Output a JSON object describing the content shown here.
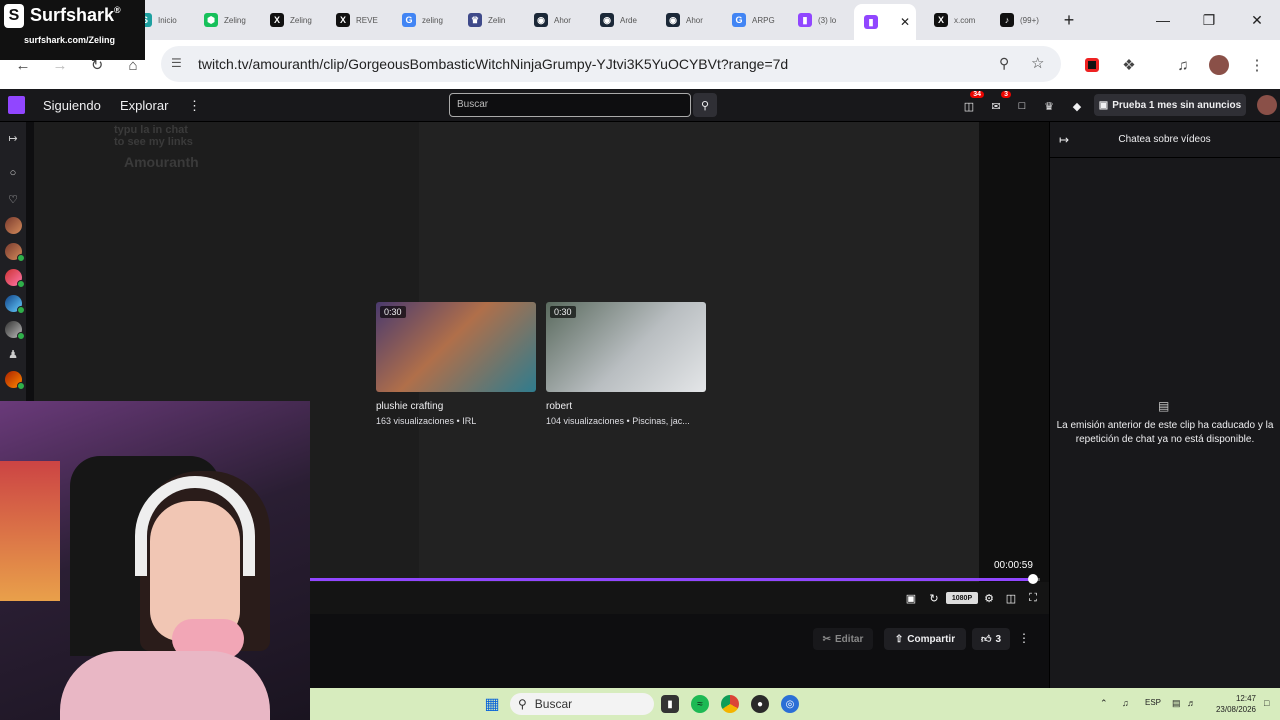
{
  "overlay": {
    "brand": "Surfshark",
    "reg": "®",
    "url": "surfshark.com/Zeling"
  },
  "browser": {
    "tabs": [
      {
        "label": "Inicio",
        "icon": "surfshark-icon",
        "color": "#1ea0a0"
      },
      {
        "label": "Zeling",
        "icon": "hexagon-icon",
        "color": "#16c05a"
      },
      {
        "label": "Zeling",
        "icon": "x-logo-icon",
        "color": "#111111"
      },
      {
        "label": "REVE",
        "icon": "x-logo-icon",
        "color": "#111111"
      },
      {
        "label": "zeling",
        "icon": "google-icon",
        "color": "#4285f4"
      },
      {
        "label": "Zelin",
        "icon": "trophy-icon",
        "color": "#3f4a8a"
      },
      {
        "label": "Ahor",
        "icon": "steam-icon",
        "color": "#1b2838"
      },
      {
        "label": "Arde",
        "icon": "steam-icon",
        "color": "#1b2838"
      },
      {
        "label": "Ahor",
        "icon": "steam-icon",
        "color": "#1b2838"
      },
      {
        "label": "ARPG",
        "icon": "google-icon",
        "color": "#4285f4"
      },
      {
        "label": "(3) lo",
        "icon": "twitch-icon",
        "color": "#9146ff"
      },
      {
        "label": "",
        "icon": "twitch-icon",
        "color": "#9146ff",
        "active": true
      },
      {
        "label": "x.com",
        "icon": "x-logo-icon",
        "color": "#111111"
      },
      {
        "label": "(99+)",
        "icon": "tiktok-icon",
        "color": "#111111"
      }
    ],
    "close_tab": "✕",
    "new_tab": "+",
    "url": "twitch.tv/amouranth/clip/GorgeousBombasticWitchNinjaGrumpy-YJtvi3K5YuOCYBVt?range=7d"
  },
  "twitch": {
    "nav": {
      "following": "Siguiendo",
      "browse": "Explorar"
    },
    "search_placeholder": "Buscar",
    "notifications": {
      "inbox": "34",
      "whispers": "3"
    },
    "prime_label": "Prueba 1 mes sin anuncios",
    "video": {
      "overlay_text": [
        "typu la in chat",
        "to see my links",
        "Amouranth"
      ],
      "time": "00:00:59",
      "quality": "1080P",
      "progress": 0.99
    },
    "suggestions": [
      {
        "duration": "0:30",
        "title": "plushie crafting",
        "meta": "163 visualizaciones • IRL"
      },
      {
        "duration": "0:30",
        "title": "robert",
        "meta": "104 visualizaciones • Piscinas, jac..."
      }
    ],
    "actions": {
      "edit": "Editar",
      "share": "Compartir",
      "likes": "3"
    },
    "chat": {
      "header": "Chatea sobre vídeos",
      "message": "La emisión anterior de este clip ha caducado y la repetición de chat ya no está disponible."
    }
  },
  "taskbar": {
    "search": "Buscar",
    "lang": "ESP",
    "time": "12:47",
    "date": "23/08/2026"
  }
}
